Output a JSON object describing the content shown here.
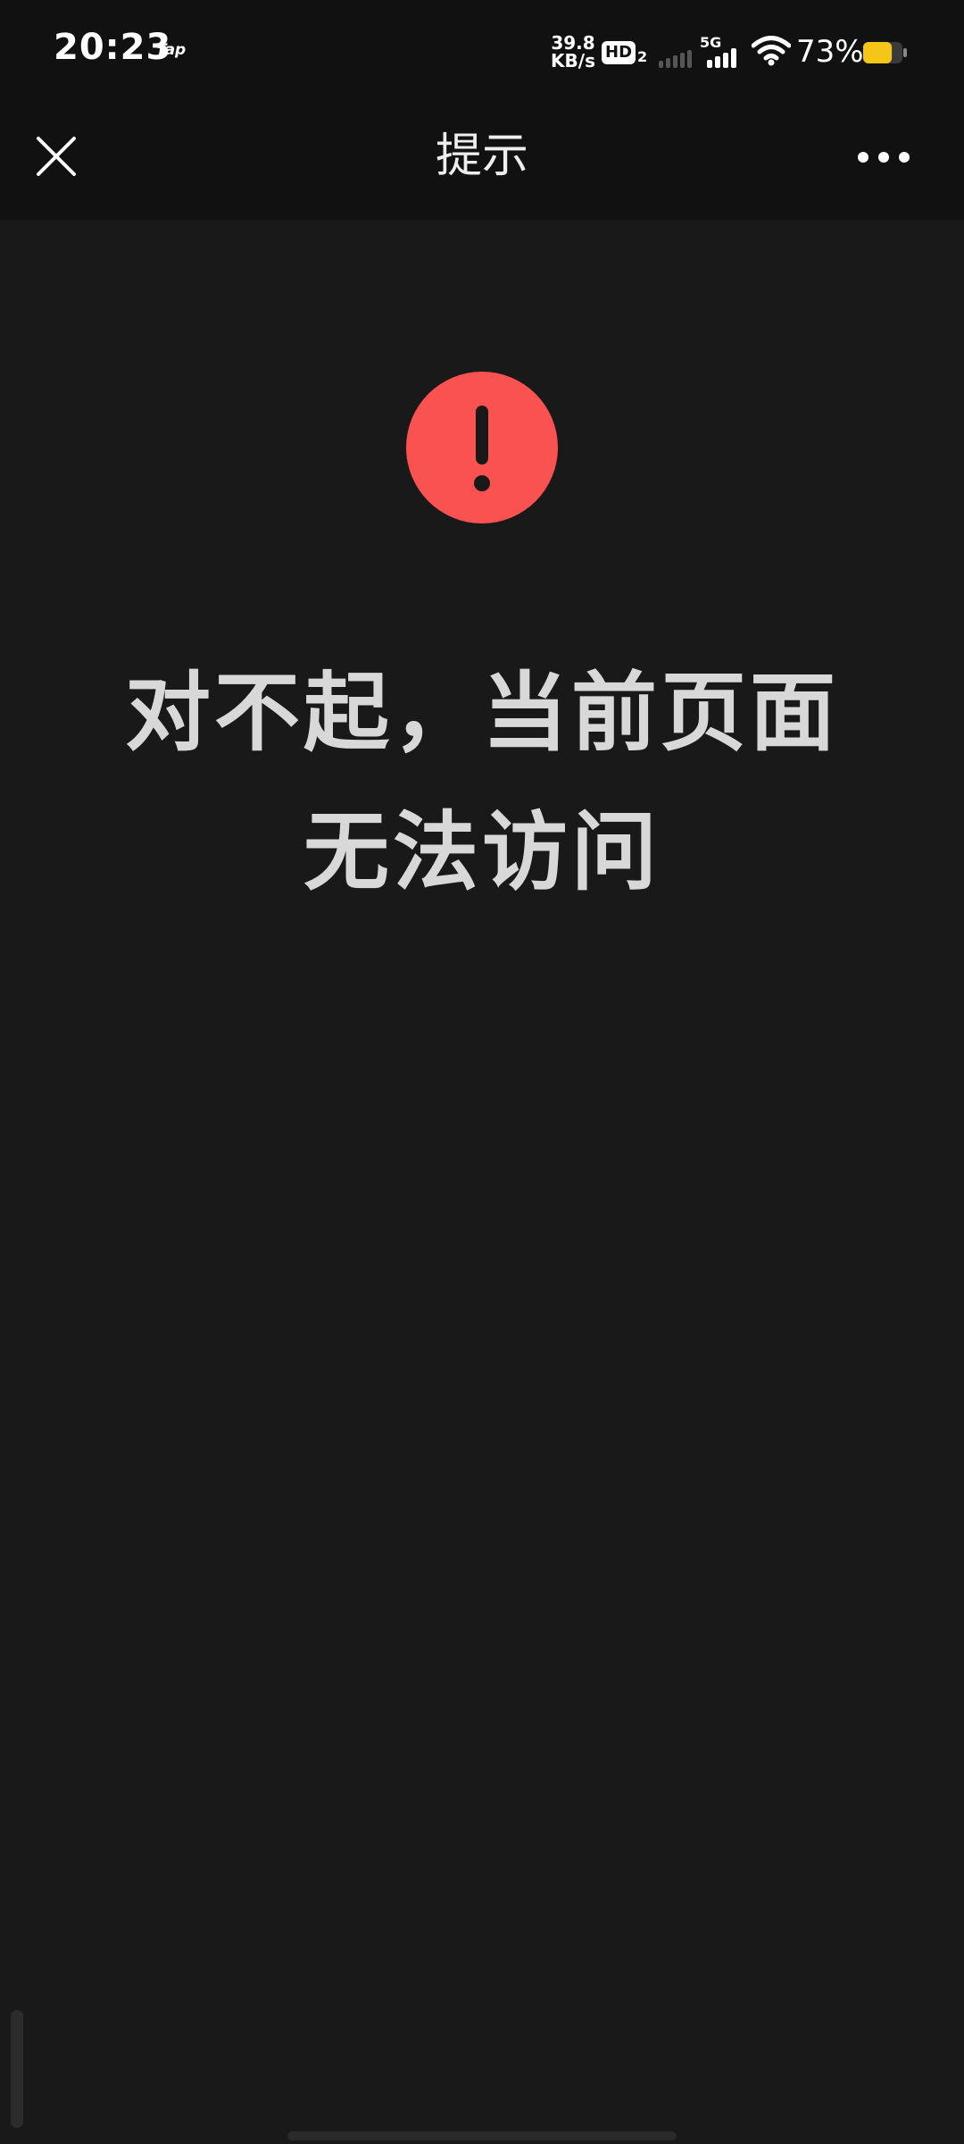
{
  "status_bar": {
    "time": "20:23",
    "app_label": "Tap",
    "net_speed_value": "39.8",
    "net_speed_unit": "KB/s",
    "hd_label": "HD",
    "hd_sub": "2",
    "network_type": "5G",
    "battery_percent": "73%",
    "battery_level": 0.73,
    "battery_color": "#f5c518",
    "icons": [
      "signal-sim1-icon",
      "signal-sim2-icon",
      "wifi-icon",
      "battery-icon"
    ]
  },
  "nav": {
    "title": "提示",
    "close_icon": "close-icon",
    "more_icon": "more-icon"
  },
  "content": {
    "error_icon": "exclamation-icon",
    "error_color": "#fa5251",
    "message_line1": "对不起，当前页面",
    "message_line2": "无法访问"
  }
}
